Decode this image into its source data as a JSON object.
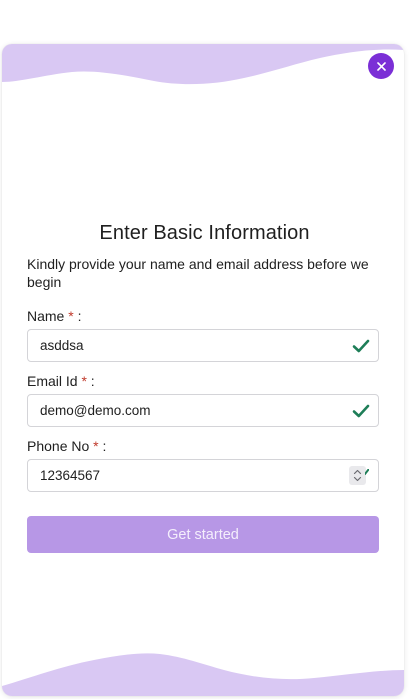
{
  "form": {
    "title": "Enter Basic Information",
    "subtitle": "Kindly provide your name and email address before we begin",
    "fields": [
      {
        "label": "Name",
        "required_mark": "*",
        "separator": " :",
        "value": "asddsa",
        "valid": true
      },
      {
        "label": "Email Id",
        "required_mark": "*",
        "separator": " :",
        "value": "demo@demo.com",
        "valid": true
      },
      {
        "label": "Phone No",
        "required_mark": "*",
        "separator": " :",
        "value": "12364567",
        "valid": true
      }
    ],
    "submit_label": "Get started"
  },
  "icons": {
    "close": "close-icon",
    "valid": "check-icon",
    "spinner": "number-spinner-icon"
  },
  "colors": {
    "accent": "#7b2fd6",
    "wave": "#d9c8f3",
    "button": "#b797e6",
    "check": "#1e7e58",
    "required": "#c0392b"
  }
}
